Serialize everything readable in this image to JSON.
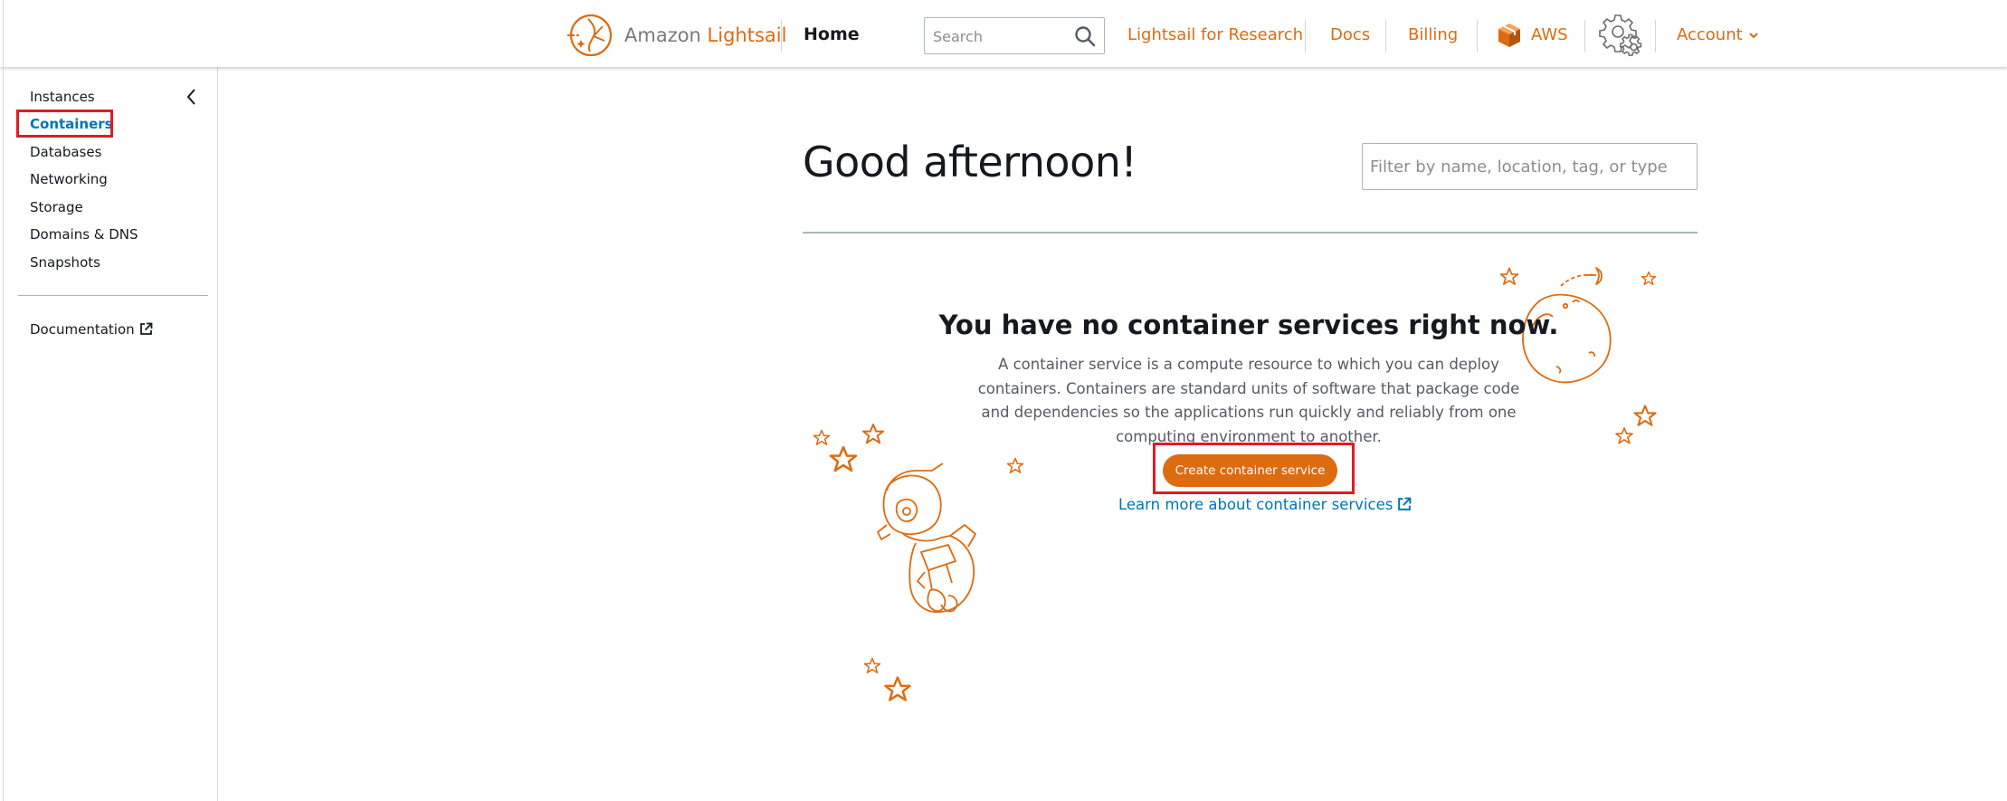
{
  "header": {
    "logo": {
      "prefix": "Amazon ",
      "brand": "Lightsail",
      "icon": "lightsail-logo-icon"
    },
    "home_label": "Home",
    "search": {
      "placeholder": "Search",
      "value": "",
      "icon": "search-icon"
    },
    "links": {
      "research": "Lightsail for Research",
      "docs": "Docs",
      "billing": "Billing",
      "aws": "AWS",
      "account": "Account"
    },
    "settings_icon": "gear-icon"
  },
  "sidebar": {
    "collapse_icon": "chevron-left-icon",
    "items": [
      {
        "label": "Instances",
        "active": false
      },
      {
        "label": "Containers",
        "active": true
      },
      {
        "label": "Databases",
        "active": false
      },
      {
        "label": "Networking",
        "active": false
      },
      {
        "label": "Storage",
        "active": false
      },
      {
        "label": "Domains & DNS",
        "active": false
      },
      {
        "label": "Snapshots",
        "active": false
      }
    ],
    "documentation_label": "Documentation"
  },
  "main": {
    "greeting": "Good afternoon!",
    "filter": {
      "placeholder": "Filter by name, location, tag, or type",
      "value": ""
    },
    "empty_state": {
      "title": "You have no container services right now.",
      "description": "A container service is a compute resource to which you can deploy containers. Containers are standard units of software that package code and dependencies so the applications run quickly and reliably from one computing environment to another.",
      "button_label": "Create container service",
      "learn_more_label": "Learn more about container services"
    }
  },
  "colors": {
    "accent": "#dd6b10",
    "link": "#0073bb",
    "highlight": "#e01b24",
    "text": "#16191f"
  }
}
